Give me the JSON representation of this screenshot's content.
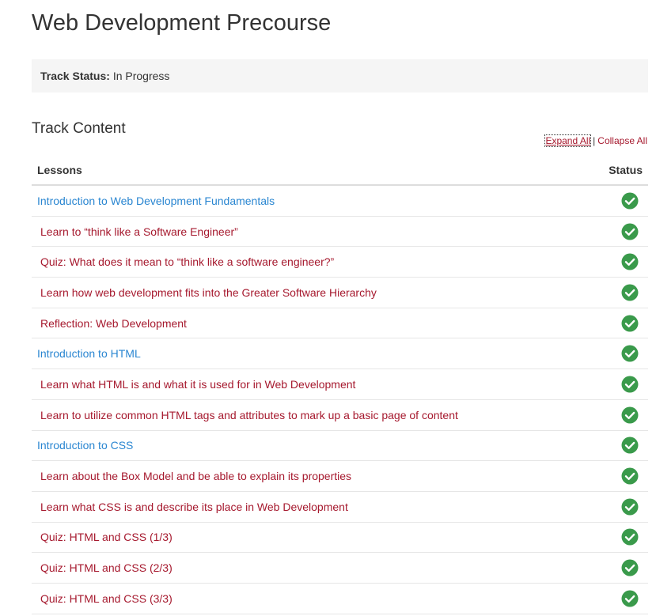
{
  "page": {
    "title": "Web Development Precourse"
  },
  "track_status": {
    "label": "Track Status:",
    "value": " In Progress"
  },
  "track_content": {
    "title": "Track Content",
    "expand_all": "Expand All",
    "separator": "|",
    "collapse_all": "Collapse All"
  },
  "table": {
    "col_lessons": "Lessons",
    "col_status": "Status",
    "status_color": "#3a9a4b",
    "rows": [
      {
        "type": "module",
        "label": "Introduction to Web Development Fundamentals",
        "status": "complete"
      },
      {
        "type": "lesson",
        "label": "Learn to “think like a Software Engineer”",
        "status": "complete"
      },
      {
        "type": "lesson",
        "label": "Quiz: What does it mean to “think like a software engineer?”",
        "status": "complete"
      },
      {
        "type": "lesson",
        "label": "Learn how web development fits into the Greater Software Hierarchy",
        "status": "complete"
      },
      {
        "type": "lesson",
        "label": "Reflection: Web Development",
        "status": "complete"
      },
      {
        "type": "module",
        "label": "Introduction to HTML",
        "status": "complete"
      },
      {
        "type": "lesson",
        "label": "Learn what HTML is and what it is used for in Web Development",
        "status": "complete"
      },
      {
        "type": "lesson",
        "label": "Learn to utilize common HTML tags and attributes to mark up a basic page of content",
        "status": "complete"
      },
      {
        "type": "module",
        "label": "Introduction to CSS",
        "status": "complete"
      },
      {
        "type": "lesson",
        "label": "Learn about the Box Model and be able to explain its properties",
        "status": "complete"
      },
      {
        "type": "lesson",
        "label": "Learn what CSS is and describe its place in Web Development",
        "status": "complete"
      },
      {
        "type": "lesson",
        "label": "Quiz: HTML and CSS (1/3)",
        "status": "complete"
      },
      {
        "type": "lesson",
        "label": "Quiz: HTML and CSS (2/3)",
        "status": "complete"
      },
      {
        "type": "lesson",
        "label": "Quiz: HTML and CSS (3/3)",
        "status": "complete"
      }
    ]
  }
}
